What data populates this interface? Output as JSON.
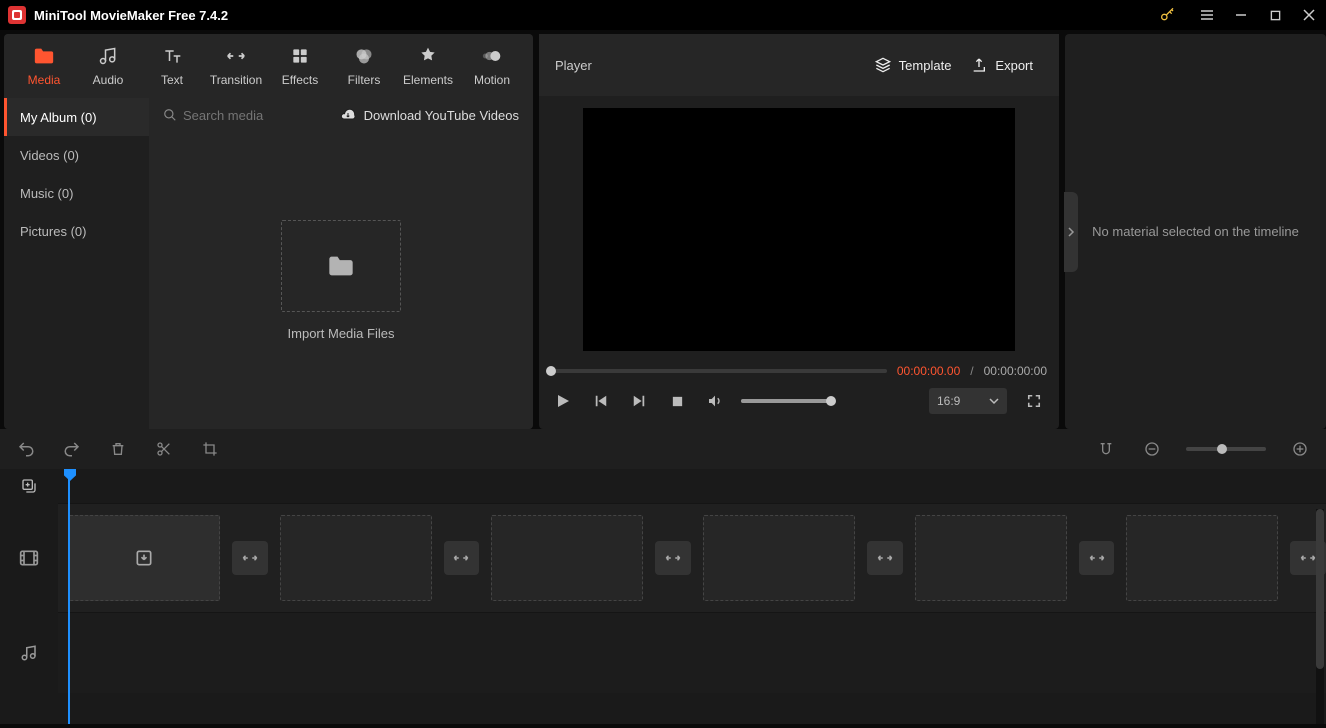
{
  "title": "MiniTool MovieMaker Free 7.4.2",
  "toptabs": [
    {
      "label": "Media",
      "icon": "folder",
      "active": true
    },
    {
      "label": "Audio",
      "icon": "music",
      "active": false
    },
    {
      "label": "Text",
      "icon": "text",
      "active": false
    },
    {
      "label": "Transition",
      "icon": "transition",
      "active": false
    },
    {
      "label": "Effects",
      "icon": "effects",
      "active": false
    },
    {
      "label": "Filters",
      "icon": "filters",
      "active": false
    },
    {
      "label": "Elements",
      "icon": "elements",
      "active": false
    },
    {
      "label": "Motion",
      "icon": "motion",
      "active": false
    }
  ],
  "sidebar": [
    {
      "label": "My Album (0)",
      "active": true
    },
    {
      "label": "Videos (0)",
      "active": false
    },
    {
      "label": "Music (0)",
      "active": false
    },
    {
      "label": "Pictures (0)",
      "active": false
    }
  ],
  "search_placeholder": "Search media",
  "download_label": "Download YouTube Videos",
  "import_label": "Import Media Files",
  "player": {
    "title": "Player",
    "template_label": "Template",
    "export_label": "Export",
    "time_current": "00:00:00.00",
    "time_separator": "/",
    "time_total": "00:00:00:00",
    "ratio": "16:9"
  },
  "props_empty": "No material selected on the timeline",
  "timeline": {
    "slot_count": 6
  }
}
